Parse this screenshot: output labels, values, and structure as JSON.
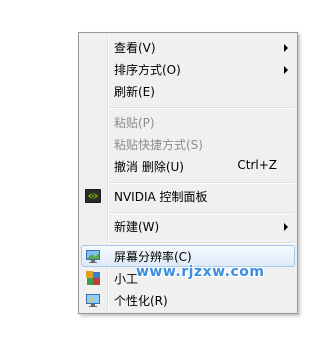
{
  "context_menu": {
    "items": [
      {
        "label": "查看(V)"
      },
      {
        "label": "排序方式(O)"
      },
      {
        "label": "刷新(E)"
      },
      {
        "label": "粘贴(P)"
      },
      {
        "label": "粘贴快捷方式(S)"
      },
      {
        "label": "撤消 删除(U)",
        "shortcut": "Ctrl+Z"
      },
      {
        "label": "NVIDIA 控制面板",
        "icon": "nvidia-icon"
      },
      {
        "label": "新建(W)"
      },
      {
        "label": "屏幕分辨率(C)",
        "icon": "screen-resolution-icon"
      },
      {
        "label": "小工",
        "icon": "gadgets-icon"
      },
      {
        "label": "个性化(R)",
        "icon": "personalize-icon"
      }
    ],
    "highlighted_item": "屏幕分辨率(C)",
    "disabled_items": [
      "粘贴(P)",
      "粘贴快捷方式(S)"
    ]
  },
  "watermark": {
    "text": "www.rjzxw.com",
    "color": "#3a8fe0"
  },
  "colors": {
    "menu_background": "#f0f0f0",
    "highlight_border": "#a8c8ec",
    "disabled_text": "#8d8d8d"
  }
}
